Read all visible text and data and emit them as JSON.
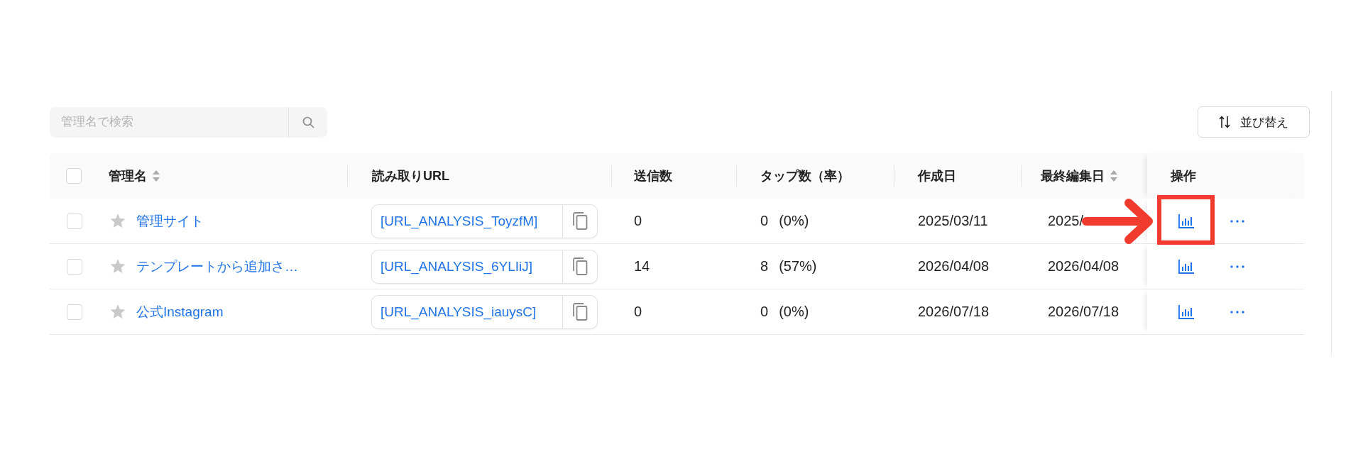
{
  "search": {
    "placeholder": "管理名で検索"
  },
  "sort_button": {
    "label": "並び替え"
  },
  "table": {
    "select_all": {
      "checked": false
    },
    "columns": [
      {
        "label": "管理名",
        "sortable": true
      },
      {
        "label": "読み取りURL",
        "sortable": false
      },
      {
        "label": "送信数",
        "sortable": false
      },
      {
        "label": "タップ数（率）",
        "sortable": false
      },
      {
        "label": "作成日",
        "sortable": false
      },
      {
        "label": "最終編集日",
        "sortable": true
      },
      {
        "label": "操作",
        "sortable": false
      }
    ],
    "rows": [
      {
        "checked": false,
        "starred": false,
        "name": "管理サイト",
        "url": "[URL_ANALYSIS_ToyzfM]",
        "sent": "0",
        "taps": "0",
        "tap_rate": "(0%)",
        "created": "2025/03/11",
        "edited": "2025/",
        "annotated": true
      },
      {
        "checked": false,
        "starred": false,
        "name": "テンプレートから追加さ…",
        "url": "[URL_ANALYSIS_6YLIiJ]",
        "sent": "14",
        "taps": "8",
        "tap_rate": "(57%)",
        "created": "2026/04/08",
        "edited": "2026/04/08",
        "annotated": false
      },
      {
        "checked": false,
        "starred": false,
        "name": "公式Instagram",
        "url": "[URL_ANALYSIS_iauysC]",
        "sent": "0",
        "taps": "0",
        "tap_rate": "(0%)",
        "created": "2026/07/18",
        "edited": "2026/07/18",
        "annotated": false
      }
    ]
  }
}
